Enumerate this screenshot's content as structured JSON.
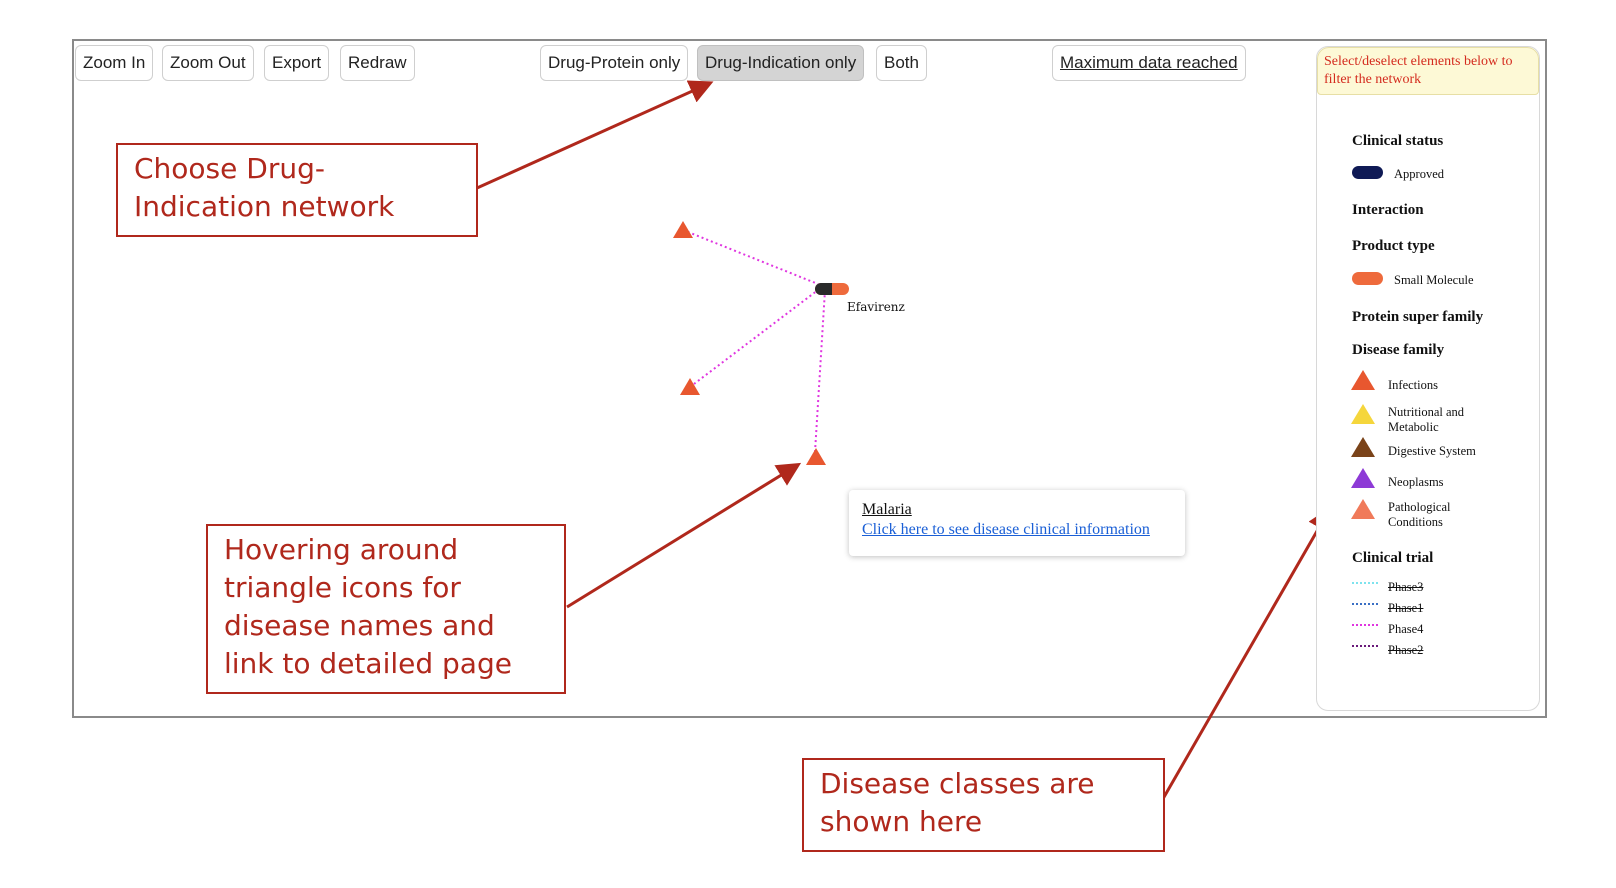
{
  "toolbar": {
    "zoom_in": "Zoom In",
    "zoom_out": "Zoom Out",
    "export": "Export",
    "redraw": "Redraw",
    "drug_protein": "Drug-Protein only",
    "drug_indication": "Drug-Indication only",
    "both": "Both",
    "max_data": "Maximum data reached"
  },
  "network": {
    "drug_name": "Efavirenz",
    "edge_color": "#e036e0",
    "disease_color": "#e8572f"
  },
  "tooltip": {
    "disease_name": "Malaria",
    "link_text": "Click here to see disease clinical information"
  },
  "legend": {
    "note": "Select/deselect elements below to filter the network",
    "clinical_status": {
      "heading": "Clinical status",
      "items": [
        {
          "label": "Approved",
          "color": "#0f1a55"
        }
      ]
    },
    "interaction": {
      "heading": "Interaction"
    },
    "product_type": {
      "heading": "Product type",
      "items": [
        {
          "label": "Small Molecule",
          "color": "#ee6a3c"
        }
      ]
    },
    "protein_super_family": {
      "heading": "Protein super family"
    },
    "disease_family": {
      "heading": "Disease family",
      "items": [
        {
          "label": "Infections",
          "color": "#e8572f"
        },
        {
          "label": "Nutritional and Metabolic",
          "color": "#f5d63c"
        },
        {
          "label": "Digestive System",
          "color": "#7a4319"
        },
        {
          "label": "Neoplasms",
          "color": "#8d3ad6"
        },
        {
          "label": "Pathological Conditions",
          "color": "#f07a5a"
        }
      ]
    },
    "clinical_trial": {
      "heading": "Clinical trial",
      "items": [
        {
          "label": "Phase3",
          "color": "#7ee3ee",
          "struck": true
        },
        {
          "label": "Phase1",
          "color": "#3a6fc4",
          "struck": true
        },
        {
          "label": "Phase4",
          "color": "#e036e0",
          "struck": false
        },
        {
          "label": "Phase2",
          "color": "#6a1a7a",
          "struck": true
        }
      ]
    }
  },
  "callouts": {
    "drug_indication": "Choose Drug-Indication network",
    "hover": "Hovering around triangle icons for disease names and link to detailed page",
    "classes": "Disease classes are shown here"
  },
  "annotation_color": "#b0281c"
}
